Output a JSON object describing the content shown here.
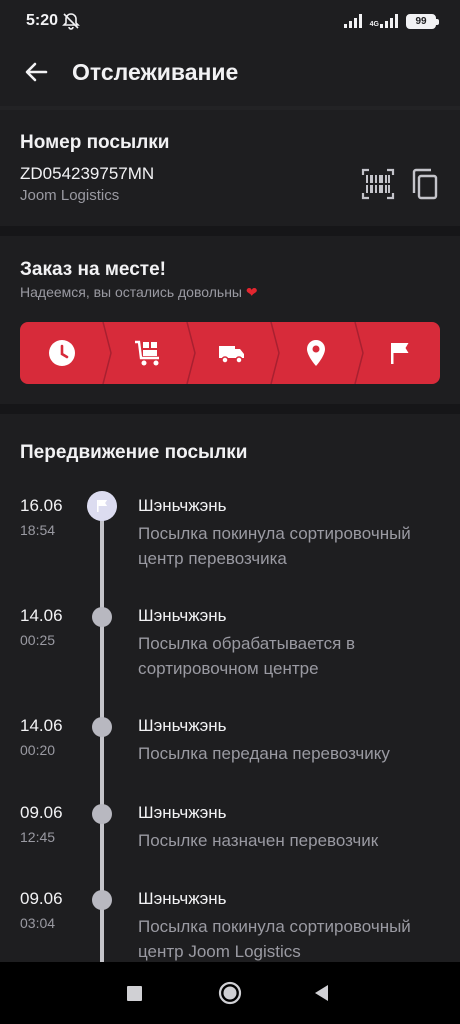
{
  "status_bar": {
    "time": "5:20",
    "network": "4G",
    "battery": "99",
    "icons": [
      "alarm-off-icon",
      "signal-icon",
      "signal-4g-icon",
      "battery-icon"
    ]
  },
  "header": {
    "title": "Отслеживание",
    "back_icon": "arrow-left-icon"
  },
  "parcel": {
    "section_title": "Номер посылки",
    "tracking_number": "ZD054239757MN",
    "carrier": "Joom Logistics",
    "actions": [
      "barcode-icon",
      "copy-icon"
    ]
  },
  "order_status": {
    "title": "Заказ на месте!",
    "subtitle": "Надеемся, вы остались довольны",
    "heart": "❤",
    "accent_color": "#d72b3a",
    "steps": [
      "clock-icon",
      "cart-boxes-icon",
      "truck-icon",
      "location-pin-icon",
      "flag-icon"
    ]
  },
  "movement": {
    "section_title": "Передвижение посылки",
    "events": [
      {
        "date": "16.06",
        "time": "18:54",
        "city": "Шэньчжэнь",
        "description": "Посылка покинула сортировочный центр перевозчика",
        "current": true
      },
      {
        "date": "14.06",
        "time": "00:25",
        "city": "Шэньчжэнь",
        "description": "Посылка обрабатывается в сортировочном центре",
        "current": false
      },
      {
        "date": "14.06",
        "time": "00:20",
        "city": "Шэньчжэнь",
        "description": "Посылка передана перевозчику",
        "current": false
      },
      {
        "date": "09.06",
        "time": "12:45",
        "city": "Шэньчжэнь",
        "description": "Посылке назначен перевозчик",
        "current": false
      },
      {
        "date": "09.06",
        "time": "03:04",
        "city": "Шэньчжэнь",
        "description": "Посылка покинула сортировочный центр Joom Logistics",
        "current": false
      }
    ]
  },
  "nav_bar": {
    "buttons": [
      "recents-square-icon",
      "home-circle-icon",
      "back-triangle-icon"
    ]
  }
}
